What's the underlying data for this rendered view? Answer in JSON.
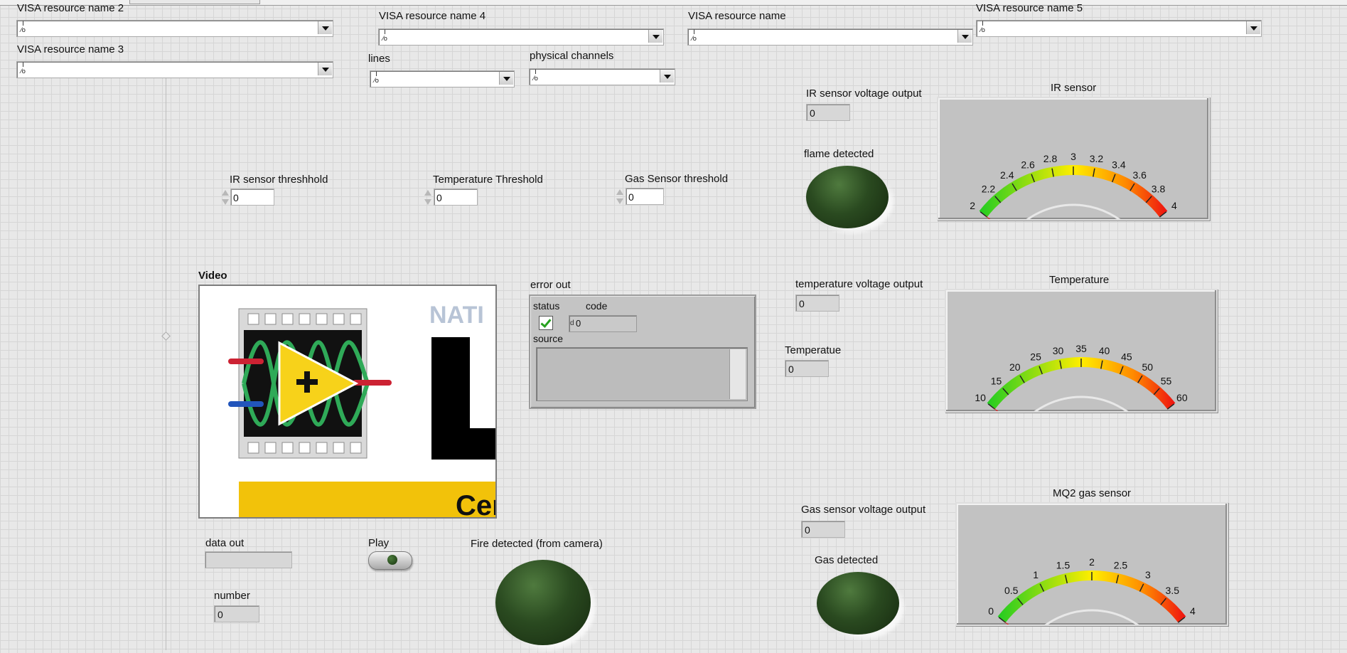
{
  "visa": {
    "name2": "VISA resource name 2",
    "name3": "VISA resource name 3",
    "name4": "VISA resource name 4",
    "name": "VISA resource name",
    "name5": "VISA resource name 5",
    "lines": "lines",
    "physical_channels": "physical channels",
    "io_glyph": "I/O"
  },
  "thresholds": {
    "ir_label": "IR sensor threshhold",
    "ir_value": "0",
    "temp_label": "Temperature Threshold",
    "temp_value": "0",
    "gas_label": "Gas Sensor threshold",
    "gas_value": "0"
  },
  "indicators": {
    "ir_voltage_label": "IR sensor voltage output",
    "ir_voltage_value": "0",
    "flame_label": "flame detected",
    "temp_voltage_label": "temperature voltage output",
    "temp_voltage_value": "0",
    "temperatue_label": "Temperatue",
    "temperatue_value": "0",
    "gas_voltage_label": "Gas sensor voltage output",
    "gas_voltage_value": "0",
    "gas_detected_label": "Gas detected",
    "fire_camera_label": "Fire detected (from camera)",
    "data_out_label": "data out",
    "data_out_value": "",
    "number_label": "number",
    "number_value": "0",
    "play_label": "Play"
  },
  "video": {
    "label": "Video",
    "logo_text_top": "NATI",
    "logo_text_bottom": "Cert"
  },
  "error_out": {
    "label": "error out",
    "status_label": "status",
    "code_label": "code",
    "code_value": "0",
    "code_prefix": "d",
    "source_label": "source"
  },
  "gauges": {
    "ir": {
      "title": "IR sensor",
      "ticks": [
        "2",
        "2.2",
        "2.4",
        "2.6",
        "2.8",
        "3",
        "3.2",
        "3.4",
        "3.6",
        "3.8",
        "4"
      ],
      "value": 0
    },
    "temperature": {
      "title": "Temperature",
      "ticks": [
        "10",
        "15",
        "20",
        "25",
        "30",
        "35",
        "40",
        "45",
        "50",
        "55",
        "60"
      ],
      "value": 0
    },
    "gas": {
      "title": "MQ2 gas sensor",
      "ticks": [
        "0",
        "0.5",
        "1",
        "1.5",
        "2",
        "2.5",
        "3",
        "3.5",
        "4"
      ],
      "value": 0
    }
  },
  "colors": {
    "led_off": "#2a4a20",
    "needle": "#e02020",
    "scale_low": "#22cc22",
    "scale_mid": "#ffee00",
    "scale_high": "#ee1111"
  }
}
